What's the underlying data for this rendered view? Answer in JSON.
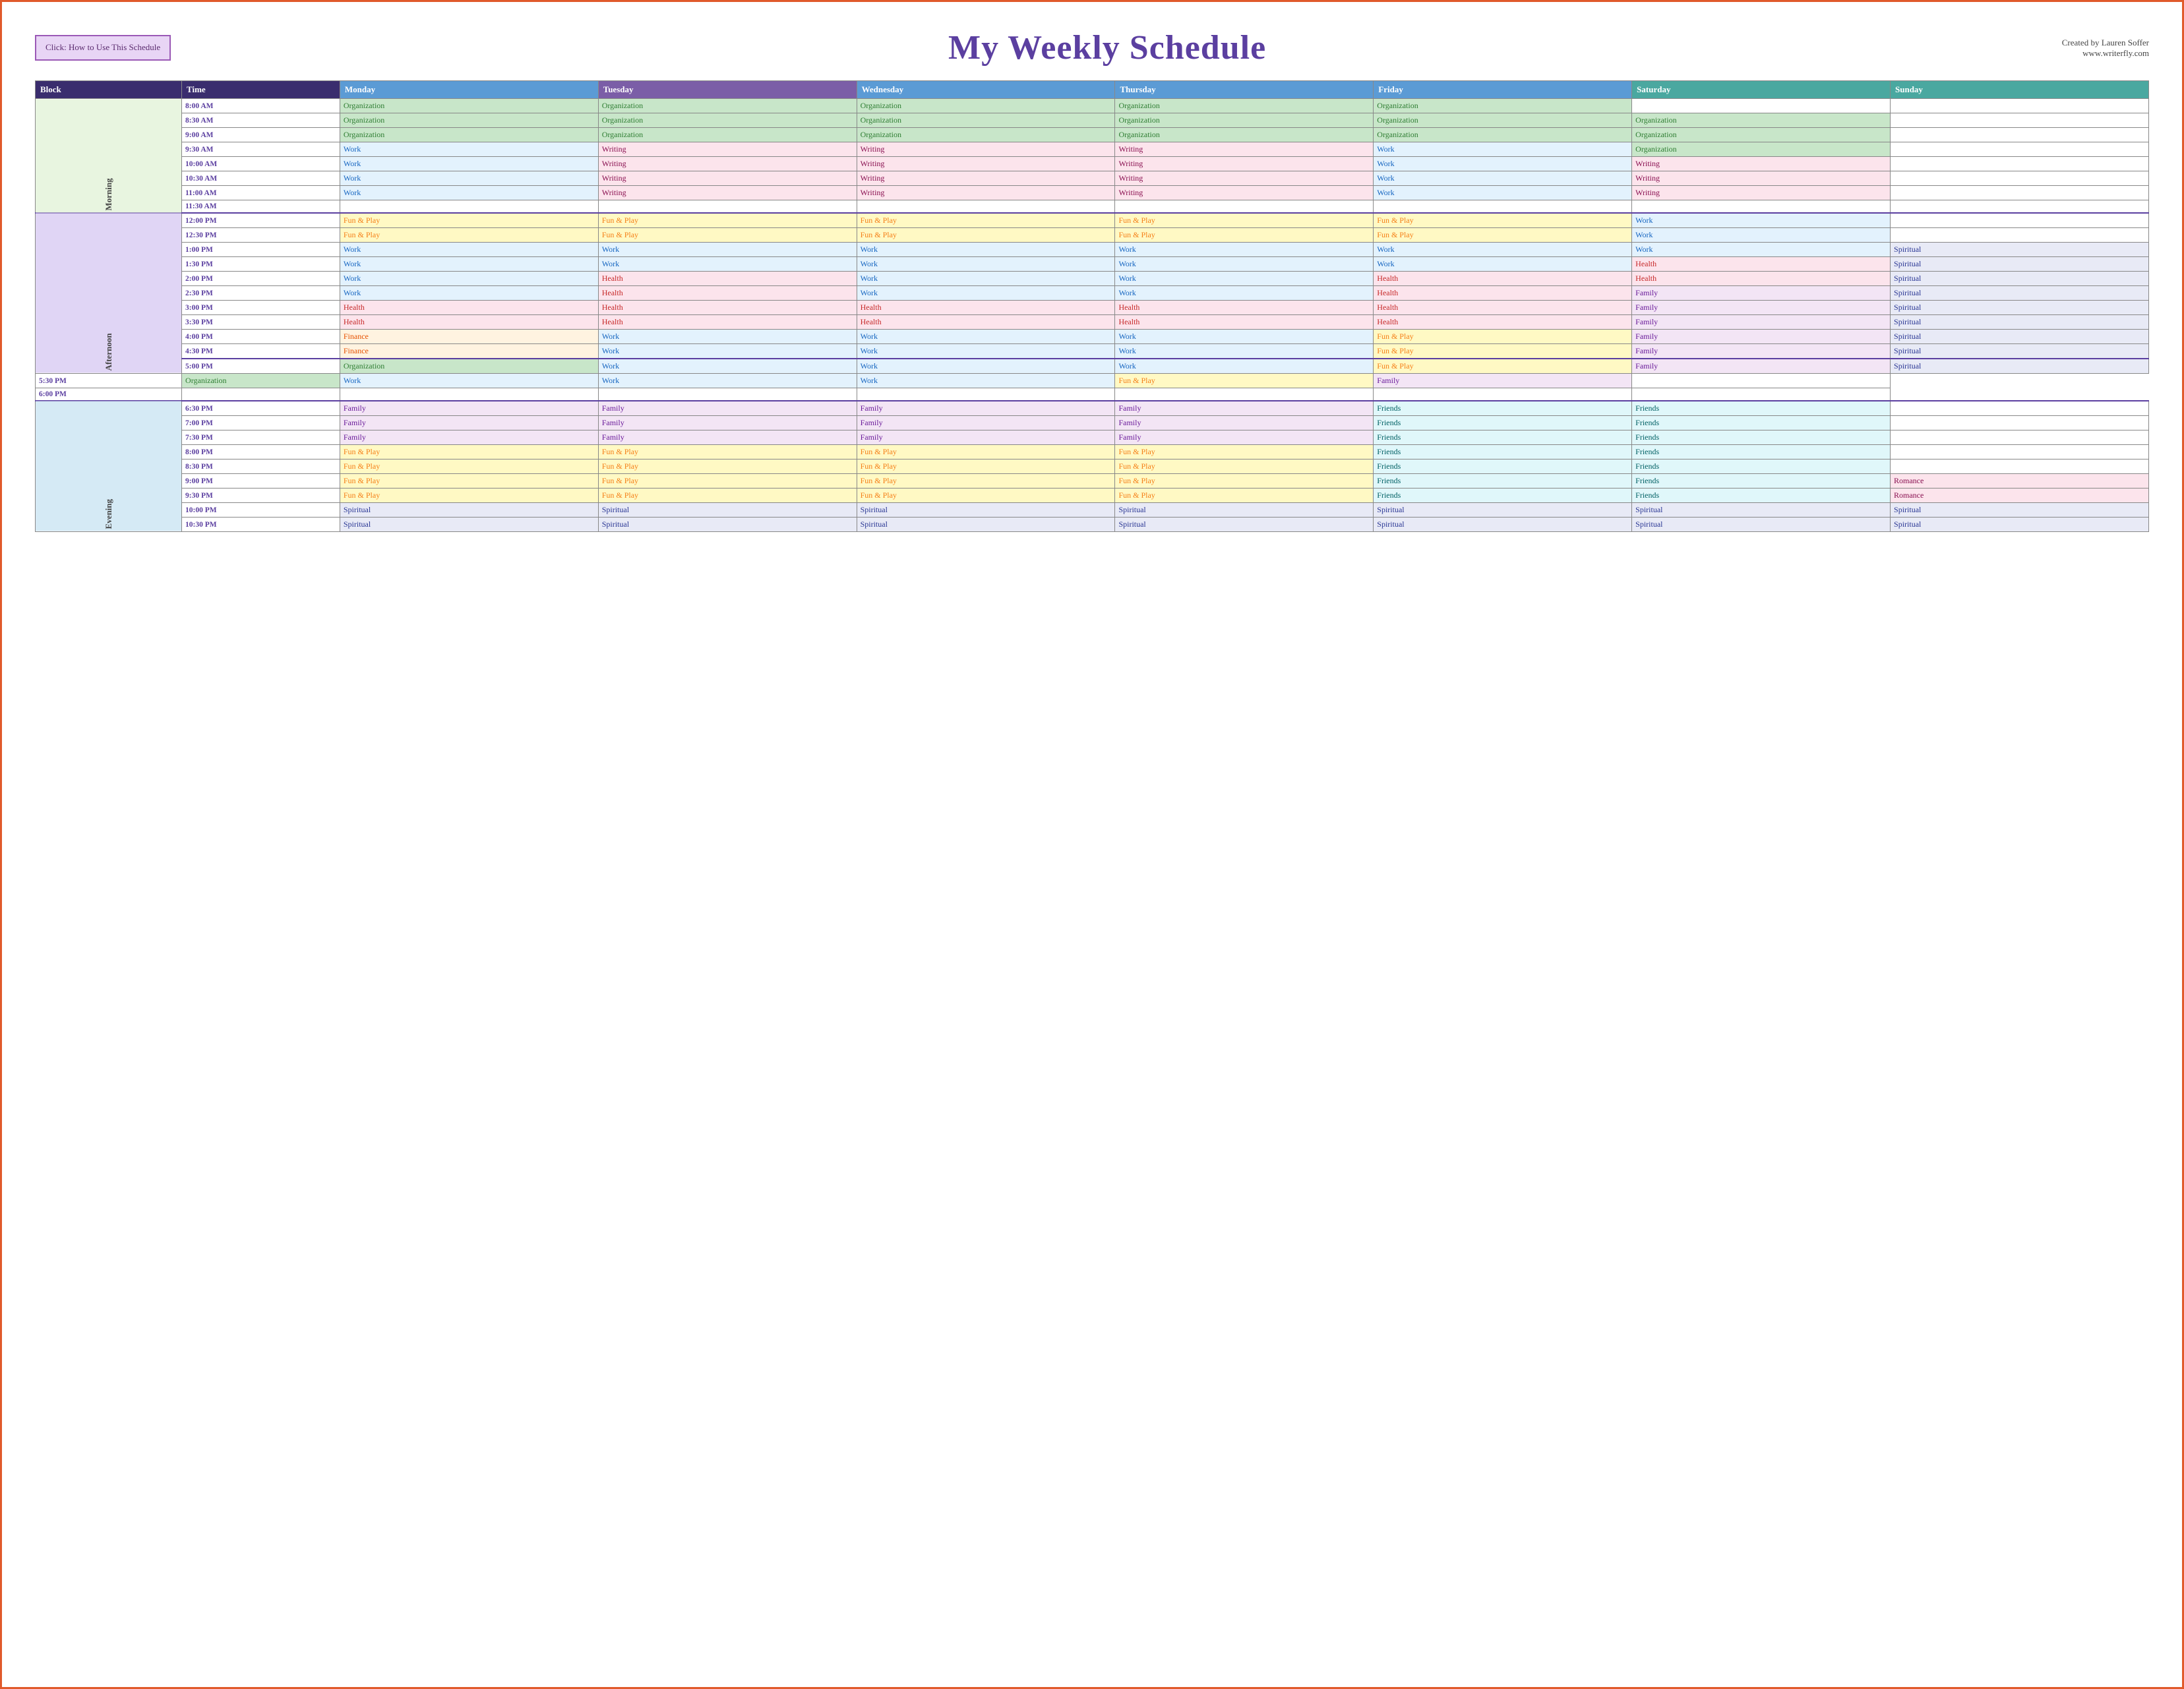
{
  "header": {
    "how_to_label": "Click:  How to Use\nThis Schedule",
    "title": "My Weekly Schedule",
    "credit_line1": "Created by Lauren Soffer",
    "credit_line2": "www.writerfly.com"
  },
  "table": {
    "headers": {
      "block": "Block",
      "time": "Time",
      "monday": "Monday",
      "tuesday": "Tuesday",
      "wednesday": "Wednesday",
      "thursday": "Thursday",
      "friday": "Friday",
      "saturday": "Saturday",
      "sunday": "Sunday"
    },
    "rows": [
      {
        "block": "Morning",
        "blockClass": "block-morning",
        "blockSpan": 8,
        "isFirstInBlock": true,
        "time": "8:00 AM",
        "mon": "Organization",
        "tue": "Organization",
        "wed": "Organization",
        "thu": "Organization",
        "fri": "Organization",
        "sat": "",
        "sun": ""
      },
      {
        "block": "",
        "isFirstInBlock": false,
        "time": "8:30 AM",
        "mon": "Organization",
        "tue": "Organization",
        "wed": "Organization",
        "thu": "Organization",
        "fri": "Organization",
        "sat": "Organization",
        "sun": ""
      },
      {
        "block": "",
        "isFirstInBlock": false,
        "time": "9:00 AM",
        "mon": "Organization",
        "tue": "Organization",
        "wed": "Organization",
        "thu": "Organization",
        "fri": "Organization",
        "sat": "Organization",
        "sun": ""
      },
      {
        "block": "",
        "isFirstInBlock": false,
        "time": "9:30 AM",
        "mon": "Work",
        "tue": "Writing",
        "wed": "Writing",
        "thu": "Writing",
        "fri": "Work",
        "sat": "Organization",
        "sun": ""
      },
      {
        "block": "",
        "isFirstInBlock": false,
        "time": "10:00 AM",
        "mon": "Work",
        "tue": "Writing",
        "wed": "Writing",
        "thu": "Writing",
        "fri": "Work",
        "sat": "Writing",
        "sun": ""
      },
      {
        "block": "",
        "isFirstInBlock": false,
        "time": "10:30 AM",
        "mon": "Work",
        "tue": "Writing",
        "wed": "Writing",
        "thu": "Writing",
        "fri": "Work",
        "sat": "Writing",
        "sun": ""
      },
      {
        "block": "",
        "isFirstInBlock": false,
        "time": "11:00 AM",
        "mon": "Work",
        "tue": "Writing",
        "wed": "Writing",
        "thu": "Writing",
        "fri": "Work",
        "sat": "Writing",
        "sun": ""
      },
      {
        "block": "",
        "isFirstInBlock": false,
        "time": "11:30 AM",
        "mon": "",
        "tue": "",
        "wed": "",
        "thu": "",
        "fri": "",
        "sat": "",
        "sun": ""
      },
      {
        "block": "Afternoon",
        "blockClass": "block-afternoon",
        "blockSpan": 11,
        "isFirstInBlock": true,
        "blockBorderTop": true,
        "time": "12:00 PM",
        "mon": "Fun & Play",
        "tue": "Fun & Play",
        "wed": "Fun & Play",
        "thu": "Fun & Play",
        "fri": "Fun & Play",
        "sat": "Work",
        "sun": ""
      },
      {
        "block": "",
        "isFirstInBlock": false,
        "time": "12:30 PM",
        "mon": "Fun & Play",
        "tue": "Fun & Play",
        "wed": "Fun & Play",
        "thu": "Fun & Play",
        "fri": "Fun & Play",
        "sat": "Work",
        "sun": ""
      },
      {
        "block": "",
        "isFirstInBlock": false,
        "time": "1:00 PM",
        "mon": "Work",
        "tue": "Work",
        "wed": "Work",
        "thu": "Work",
        "fri": "Work",
        "sat": "Work",
        "sun": "Spiritual"
      },
      {
        "block": "",
        "isFirstInBlock": false,
        "time": "1:30 PM",
        "mon": "Work",
        "tue": "Work",
        "wed": "Work",
        "thu": "Work",
        "fri": "Work",
        "sat": "Health",
        "sun": "Spiritual"
      },
      {
        "block": "",
        "isFirstInBlock": false,
        "time": "2:00 PM",
        "mon": "Work",
        "tue": "Health",
        "wed": "Work",
        "thu": "Work",
        "fri": "Health",
        "sat": "Health",
        "sun": "Spiritual"
      },
      {
        "block": "",
        "isFirstInBlock": false,
        "time": "2:30 PM",
        "mon": "Work",
        "tue": "Health",
        "wed": "Work",
        "thu": "Work",
        "fri": "Health",
        "sat": "Family",
        "sun": "Spiritual"
      },
      {
        "block": "",
        "isFirstInBlock": false,
        "time": "3:00 PM",
        "mon": "Health",
        "tue": "Health",
        "wed": "Health",
        "thu": "Health",
        "fri": "Health",
        "sat": "Family",
        "sun": "Spiritual"
      },
      {
        "block": "",
        "isFirstInBlock": false,
        "time": "3:30 PM",
        "mon": "Health",
        "tue": "Health",
        "wed": "Health",
        "thu": "Health",
        "fri": "Health",
        "sat": "Family",
        "sun": "Spiritual"
      },
      {
        "block": "",
        "isFirstInBlock": false,
        "time": "4:00 PM",
        "mon": "Finance",
        "tue": "Work",
        "wed": "Work",
        "thu": "Work",
        "fri": "Fun & Play",
        "sat": "Family",
        "sun": "Spiritual"
      },
      {
        "block": "",
        "isFirstInBlock": false,
        "time": "4:30 PM",
        "mon": "Finance",
        "tue": "Work",
        "wed": "Work",
        "thu": "Work",
        "fri": "Fun & Play",
        "sat": "Family",
        "sun": "Spiritual"
      },
      {
        "block": "",
        "isFirstInBlock": false,
        "blockBorderTop": true,
        "time": "5:00 PM",
        "mon": "Organization",
        "tue": "Work",
        "wed": "Work",
        "thu": "Work",
        "fri": "Fun & Play",
        "sat": "Family",
        "sun": "Spiritual"
      },
      {
        "block": "",
        "isFirstInBlock": false,
        "time": "5:30 PM",
        "mon": "Organization",
        "tue": "Work",
        "wed": "Work",
        "thu": "Work",
        "fri": "Fun & Play",
        "sat": "Family",
        "sun": ""
      },
      {
        "block": "",
        "isFirstInBlock": false,
        "time": "6:00 PM",
        "mon": "",
        "tue": "",
        "wed": "",
        "thu": "",
        "fri": "",
        "sat": "",
        "sun": ""
      },
      {
        "block": "Evening",
        "blockClass": "block-evening",
        "blockSpan": 11,
        "isFirstInBlock": true,
        "blockBorderTop": true,
        "time": "6:30 PM",
        "mon": "Family",
        "tue": "Family",
        "wed": "Family",
        "thu": "Family",
        "fri": "Friends",
        "sat": "Friends",
        "sun": ""
      },
      {
        "block": "",
        "isFirstInBlock": false,
        "time": "7:00 PM",
        "mon": "Family",
        "tue": "Family",
        "wed": "Family",
        "thu": "Family",
        "fri": "Friends",
        "sat": "Friends",
        "sun": ""
      },
      {
        "block": "",
        "isFirstInBlock": false,
        "time": "7:30 PM",
        "mon": "Family",
        "tue": "Family",
        "wed": "Family",
        "thu": "Family",
        "fri": "Friends",
        "sat": "Friends",
        "sun": ""
      },
      {
        "block": "",
        "isFirstInBlock": false,
        "time": "8:00 PM",
        "mon": "Fun & Play",
        "tue": "Fun & Play",
        "wed": "Fun & Play",
        "thu": "Fun & Play",
        "fri": "Friends",
        "sat": "Friends",
        "sun": ""
      },
      {
        "block": "",
        "isFirstInBlock": false,
        "time": "8:30 PM",
        "mon": "Fun & Play",
        "tue": "Fun & Play",
        "wed": "Fun & Play",
        "thu": "Fun & Play",
        "fri": "Friends",
        "sat": "Friends",
        "sun": ""
      },
      {
        "block": "",
        "isFirstInBlock": false,
        "time": "9:00 PM",
        "mon": "Fun & Play",
        "tue": "Fun & Play",
        "wed": "Fun & Play",
        "thu": "Fun & Play",
        "fri": "Friends",
        "sat": "Friends",
        "sun": "Romance"
      },
      {
        "block": "",
        "isFirstInBlock": false,
        "time": "9:30 PM",
        "mon": "Fun & Play",
        "tue": "Fun & Play",
        "wed": "Fun & Play",
        "thu": "Fun & Play",
        "fri": "Friends",
        "sat": "Friends",
        "sun": "Romance"
      },
      {
        "block": "",
        "isFirstInBlock": false,
        "time": "10:00 PM",
        "mon": "Spiritual",
        "tue": "Spiritual",
        "wed": "Spiritual",
        "thu": "Spiritual",
        "fri": "Spiritual",
        "sat": "Spiritual",
        "sun": "Spiritual"
      },
      {
        "block": "",
        "isFirstInBlock": false,
        "time": "10:30 PM",
        "mon": "Spiritual",
        "tue": "Spiritual",
        "wed": "Spiritual",
        "thu": "Spiritual",
        "fri": "Spiritual",
        "sat": "Spiritual",
        "sun": "Spiritual"
      }
    ]
  }
}
